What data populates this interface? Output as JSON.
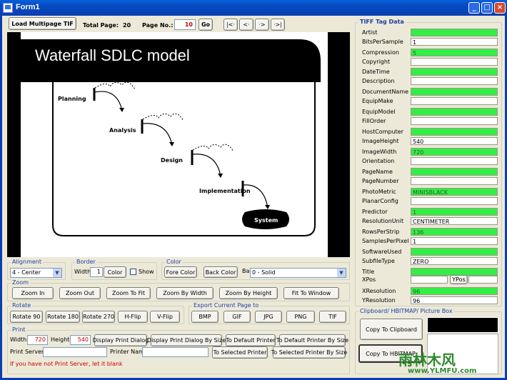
{
  "window": {
    "title": "Form1"
  },
  "toolbar": {
    "load_label": "Load Multipage TIF",
    "total_page_label": "Total Page:",
    "total_page_value": "20",
    "page_no_label": "Page No.:",
    "page_no_value": "10",
    "go_label": "Go",
    "first_label": "|<·",
    "prev_label": "<·",
    "next_label": "·>",
    "last_label": "·>|"
  },
  "page_image": {
    "title": "Waterfall SDLC model",
    "steps": [
      "Planning",
      "Analysis",
      "Design",
      "Implementation",
      "System"
    ]
  },
  "alignment": {
    "title": "Alignment",
    "value": "4 - Center"
  },
  "border": {
    "title": "Border",
    "width_label": "Width",
    "width_value": "1",
    "color_label": "Color",
    "show_label": "Show"
  },
  "color": {
    "title": "Color",
    "fore_label": "Fore Color",
    "back_label": "Back Color",
    "back_style_label": "Back Style",
    "back_style_value": "0 - Solid"
  },
  "zoom": {
    "title": "Zoom",
    "buttons": [
      "Zoom In",
      "Zoom Out",
      "Zoom To Fit",
      "Zoom By Width",
      "Zoom By Height",
      "Fit To Window"
    ]
  },
  "rotate": {
    "title": "Rotate",
    "buttons": [
      "Rotate 90",
      "Rotate 180",
      "Rotate 270",
      "H-Flip",
      "V-Flip"
    ]
  },
  "export": {
    "title": "Export Current Page to",
    "buttons": [
      "BMP",
      "GIF",
      "JPG",
      "PNG",
      "TIF"
    ]
  },
  "print": {
    "title": "Print",
    "width_label": "Width",
    "width_value": "720",
    "height_label": "Height",
    "height_value": "540",
    "display_dialog": "Display Print Dialog",
    "display_dialog_size": "Display Print Dialog By Size",
    "default_printer": "To Default Printer",
    "default_printer_size": "To Default Printer By Size",
    "server_label": "Print Server",
    "printer_name_label": "Printer Name",
    "selected_printer": "To Selected Printer",
    "selected_printer_size": "To Selected Printer By Size",
    "hint": "If you have not Print Server, let it blank"
  },
  "tiff": {
    "title": "TIFF Tag Data",
    "tags": [
      {
        "label": "Artist",
        "value": "",
        "color": "green"
      },
      {
        "label": "BitsPerSample",
        "value": "1",
        "color": "white"
      },
      {
        "label": "Compression",
        "value": "5",
        "color": "green"
      },
      {
        "label": "Copyright",
        "value": "",
        "color": "white"
      },
      {
        "label": "DateTime",
        "value": "",
        "color": "green"
      },
      {
        "label": "Description",
        "value": "",
        "color": "white"
      },
      {
        "label": "DocumentName",
        "value": "",
        "color": "green"
      },
      {
        "label": "EquipMake",
        "value": "",
        "color": "white"
      },
      {
        "label": "EquipModel",
        "value": "",
        "color": "green"
      },
      {
        "label": "FillOrder",
        "value": "",
        "color": "white"
      },
      {
        "label": "HostComputer",
        "value": "",
        "color": "green"
      },
      {
        "label": "ImageHeight",
        "value": "540",
        "color": "white"
      },
      {
        "label": "ImageWidth",
        "value": "720",
        "color": "green"
      },
      {
        "label": "Orientation",
        "value": "",
        "color": "white"
      },
      {
        "label": "PageName",
        "value": "",
        "color": "green"
      },
      {
        "label": "PageNumber",
        "value": "",
        "color": "white"
      },
      {
        "label": "PhotoMetric",
        "value": "MINISBLACK",
        "color": "green"
      },
      {
        "label": "PlanarConfig",
        "value": "",
        "color": "white"
      },
      {
        "label": "Predictor",
        "value": "1",
        "color": "green"
      },
      {
        "label": "ResolutionUnit",
        "value": "CENTIMETER",
        "color": "white"
      },
      {
        "label": "RowsPerStrip",
        "value": "136",
        "color": "green"
      },
      {
        "label": "SamplesPerPixel",
        "value": "1",
        "color": "white"
      },
      {
        "label": "SoftwareUsed",
        "value": "",
        "color": "green"
      },
      {
        "label": "SubfileType",
        "value": "ZERO",
        "color": "white"
      },
      {
        "label": "Title",
        "value": "",
        "color": "green"
      }
    ],
    "xpos_label": "XPos",
    "ypos_label": "YPos",
    "xres_label": "XResolution",
    "xres_value": "96",
    "yres_label": "YResolution",
    "yres_value": "96"
  },
  "clipboard": {
    "title": "Clipboard/ HBITMAP/ Picture Box",
    "copy_label": "Copy To Clipboard",
    "hbitmap_label": "Copy To HBITMAP"
  },
  "watermark": {
    "line1": "雨林木风",
    "line2": "www.YLMFU.com"
  }
}
